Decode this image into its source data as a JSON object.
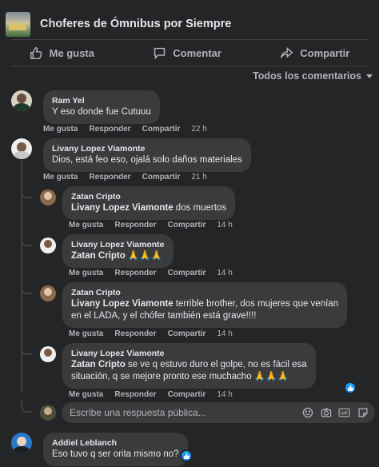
{
  "post": {
    "group_name": "Choferes de Ómnibus por Siempre"
  },
  "actions": {
    "like": "Me gusta",
    "comment": "Comentar",
    "share": "Compartir"
  },
  "sort_label": "Todos los comentarios",
  "meta_labels": {
    "like": "Me gusta",
    "reply": "Responder",
    "share": "Compartir"
  },
  "comments": [
    {
      "author": "Ram Yel",
      "text": "Y eso donde fue Cutuuu",
      "time": "22 h"
    },
    {
      "author": "Livany Lopez Viamonte",
      "text": "Dios, está feo eso, ojalá solo daños materiales",
      "time": "21 h"
    }
  ],
  "replies": [
    {
      "author": "Zatan Cripto",
      "mention": "Livany Lopez Viamonte",
      "text": " dos muertos",
      "time": "14 h"
    },
    {
      "author": "Livany Lopez Viamonte",
      "mention": "Zatan Cripto",
      "text": " 🙏🙏🙏",
      "time": "14 h"
    },
    {
      "author": "Zatan Cripto",
      "mention": "Livany Lopez Viamonte",
      "text": " terrible brother, dos mujeres que venían",
      "text2": "en el LADA, y el chófer también está grave!!!!",
      "time": "14 h"
    },
    {
      "author": "Livany Lopez Viamonte",
      "mention": "Zatan Cripto",
      "text": " se ve q estuvo duro el golpe, no es fácil esa",
      "text2": "situación, q se mejore pronto ese muchacho 🙏🙏🙏",
      "time": "14 h"
    }
  ],
  "reply_box": {
    "placeholder": "Escribe una respuesta pública..."
  },
  "last_comment": {
    "author": "Addiel Leblanch",
    "text": "Eso tuvo q ser orita mismo no?"
  },
  "colors": {
    "background": "#242526",
    "bubble": "#3a3b3c",
    "text": "#e4e6eb",
    "muted": "#b0b3b8",
    "like_blue": "#0a7cff"
  }
}
